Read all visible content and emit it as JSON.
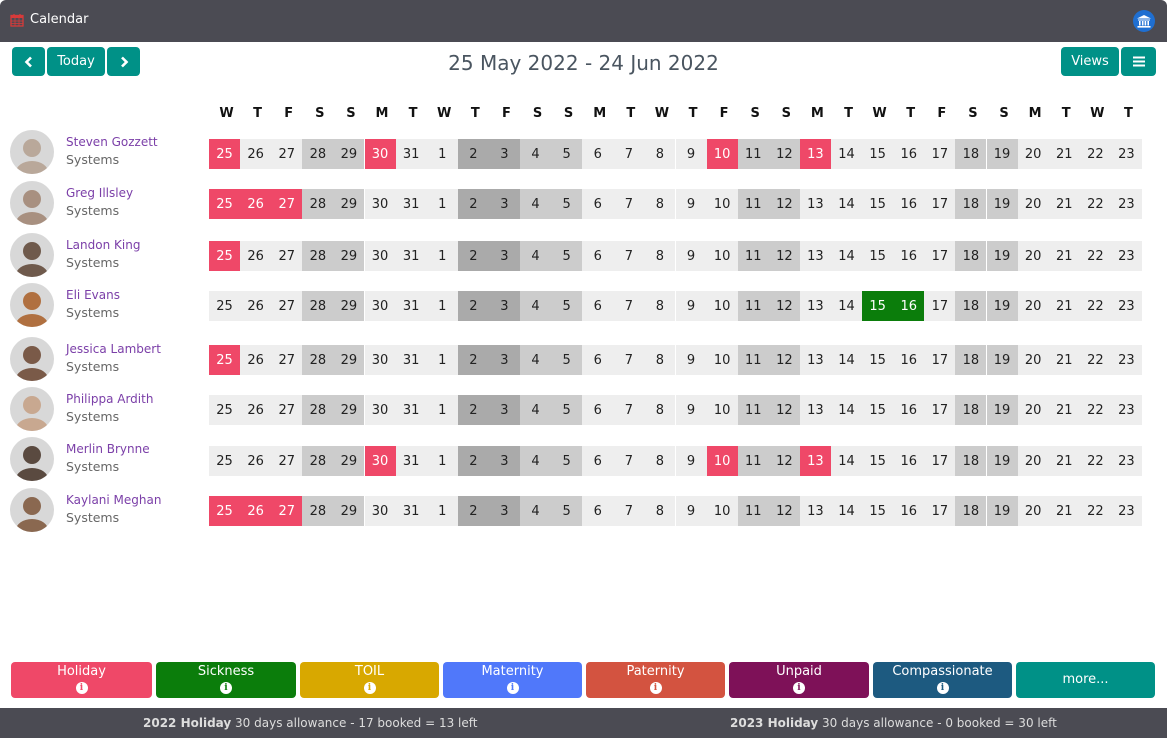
{
  "app": {
    "title": "Calendar",
    "icons": {
      "app": "calendar-icon",
      "account": "bank-icon"
    }
  },
  "toolbar": {
    "prev_icon": "‹",
    "today_label": "Today",
    "next_icon": "›",
    "range_title": "25 May 2022 - 24 Jun 2022",
    "views_label": "Views",
    "menu_icon": "≡"
  },
  "colors": {
    "Holiday": "#ef4868",
    "Sickness": "#0b7d0b",
    "TOIL": "#d8a800",
    "Maternity": "#5078fa",
    "Paternity": "#d35340",
    "Unpaid": "#7e1158",
    "Compassionate": "#1d5a80",
    "more": "#009187",
    "weekday": "#eeeeee",
    "weekend": "#cccccc",
    "bank_holiday": "#aaaaaa"
  },
  "days": [
    {
      "dow": "W",
      "d": "25",
      "t": "wd"
    },
    {
      "dow": "T",
      "d": "26",
      "t": "wd"
    },
    {
      "dow": "F",
      "d": "27",
      "t": "wd"
    },
    {
      "dow": "S",
      "d": "28",
      "t": "we"
    },
    {
      "dow": "S",
      "d": "29",
      "t": "we"
    },
    {
      "dow": "M",
      "d": "30",
      "t": "wd"
    },
    {
      "dow": "T",
      "d": "31",
      "t": "wd"
    },
    {
      "dow": "W",
      "d": "1",
      "t": "wd"
    },
    {
      "dow": "T",
      "d": "2",
      "t": "bh"
    },
    {
      "dow": "F",
      "d": "3",
      "t": "bh"
    },
    {
      "dow": "S",
      "d": "4",
      "t": "we"
    },
    {
      "dow": "S",
      "d": "5",
      "t": "we"
    },
    {
      "dow": "M",
      "d": "6",
      "t": "wd"
    },
    {
      "dow": "T",
      "d": "7",
      "t": "wd"
    },
    {
      "dow": "W",
      "d": "8",
      "t": "wd"
    },
    {
      "dow": "T",
      "d": "9",
      "t": "wd"
    },
    {
      "dow": "F",
      "d": "10",
      "t": "wd"
    },
    {
      "dow": "S",
      "d": "11",
      "t": "we"
    },
    {
      "dow": "S",
      "d": "12",
      "t": "we"
    },
    {
      "dow": "M",
      "d": "13",
      "t": "wd"
    },
    {
      "dow": "T",
      "d": "14",
      "t": "wd"
    },
    {
      "dow": "W",
      "d": "15",
      "t": "wd"
    },
    {
      "dow": "T",
      "d": "16",
      "t": "wd"
    },
    {
      "dow": "F",
      "d": "17",
      "t": "wd"
    },
    {
      "dow": "S",
      "d": "18",
      "t": "we"
    },
    {
      "dow": "S",
      "d": "19",
      "t": "we"
    },
    {
      "dow": "M",
      "d": "20",
      "t": "wd"
    },
    {
      "dow": "T",
      "d": "21",
      "t": "wd"
    },
    {
      "dow": "W",
      "d": "22",
      "t": "wd"
    },
    {
      "dow": "T",
      "d": "23",
      "t": "wd"
    }
  ],
  "people": [
    {
      "name": "Steven Gozzett",
      "dept": "Systems",
      "avatar": "avatar-photo",
      "leave": {
        "0": "hol",
        "5": "hol",
        "16": "hol",
        "19": "hol"
      }
    },
    {
      "name": "Greg Illsley",
      "dept": "Systems",
      "avatar": "avatar-photo",
      "leave": {
        "0": "hol",
        "1": "hol",
        "2": "hol"
      }
    },
    {
      "name": "Landon King",
      "dept": "Systems",
      "avatar": "avatar-photo",
      "leave": {
        "0": "hol"
      }
    },
    {
      "name": "Eli Evans",
      "dept": "Systems",
      "avatar": "avatar-photo",
      "leave": {
        "21": "sick",
        "22": "sick"
      }
    },
    {
      "name": "Jessica Lambert",
      "dept": "Systems",
      "avatar": "avatar-photo",
      "leave": {
        "0": "hol"
      }
    },
    {
      "name": "Philippa Ardith",
      "dept": "Systems",
      "avatar": "avatar-photo",
      "leave": {}
    },
    {
      "name": "Merlin Brynne",
      "dept": "Systems",
      "avatar": "avatar-photo",
      "leave": {
        "5": "hol",
        "16": "hol",
        "19": "hol"
      }
    },
    {
      "name": "Kaylani Meghan",
      "dept": "Systems",
      "avatar": "avatar-photo",
      "leave": {
        "0": "hol",
        "1": "hol",
        "2": "hol"
      }
    }
  ],
  "legend": [
    {
      "label": "Holiday",
      "info": "i"
    },
    {
      "label": "Sickness",
      "info": "i"
    },
    {
      "label": "TOIL",
      "info": "i"
    },
    {
      "label": "Maternity",
      "info": "i"
    },
    {
      "label": "Paternity",
      "info": "i"
    },
    {
      "label": "Unpaid",
      "info": "i"
    },
    {
      "label": "Compassionate",
      "info": "i"
    },
    {
      "label": "more...",
      "info": null
    }
  ],
  "footer": {
    "y2022": {
      "bold": "2022 Holiday",
      "text": " 30 days allowance - 17 booked = 13 left"
    },
    "y2023": {
      "bold": "2023 Holiday",
      "text": " 30 days allowance - 0 booked = 30 left"
    }
  }
}
